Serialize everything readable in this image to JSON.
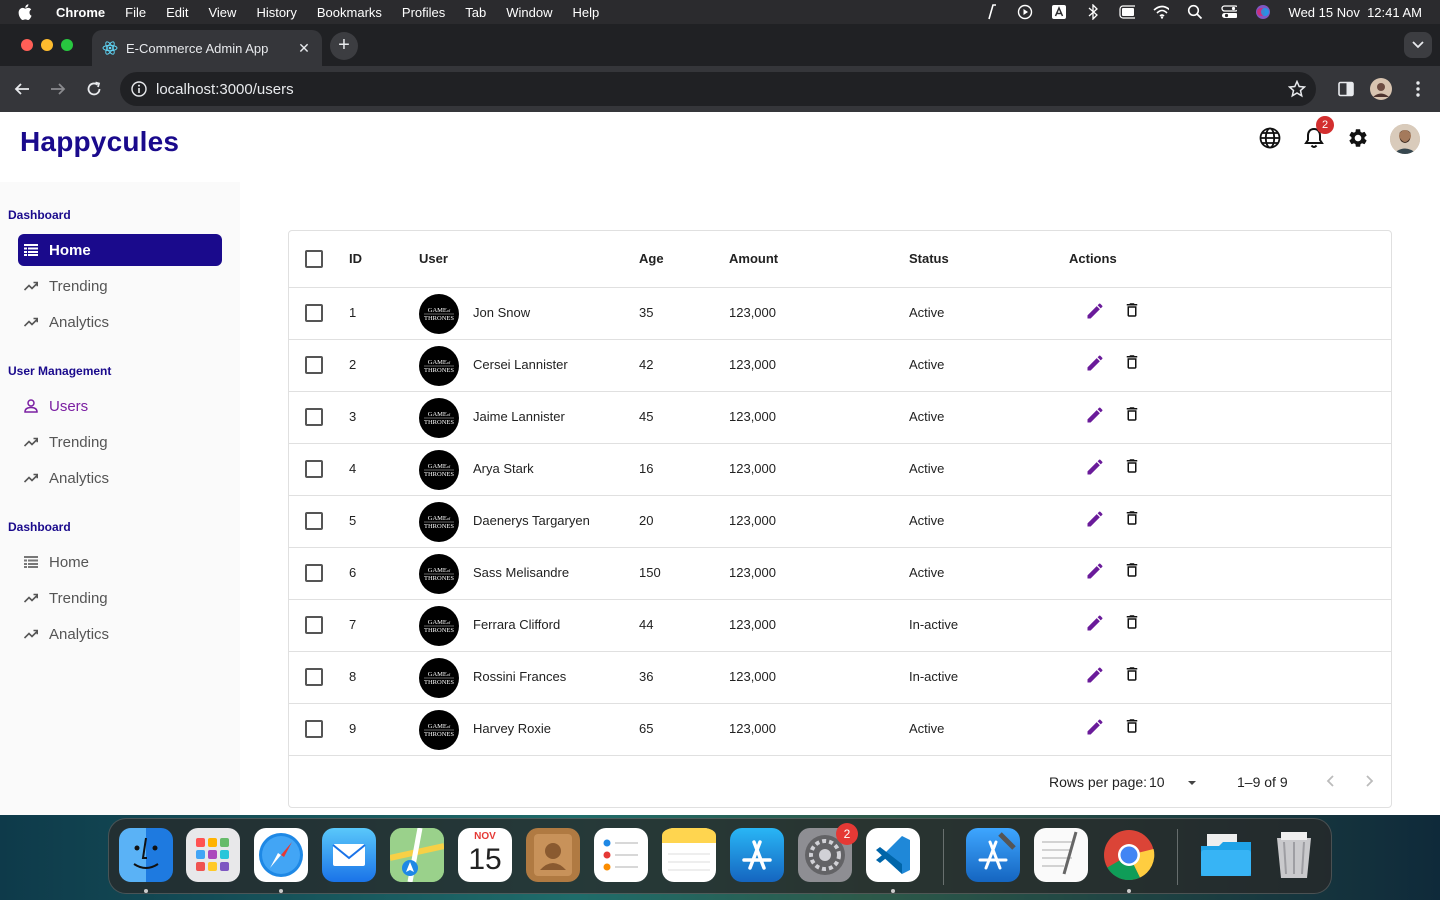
{
  "menubar": {
    "app": "Chrome",
    "items": [
      "File",
      "Edit",
      "View",
      "History",
      "Bookmarks",
      "Profiles",
      "Tab",
      "Window",
      "Help"
    ],
    "datetime": "Wed 15 Nov  12:41 AM"
  },
  "browser": {
    "tab_title": "E-Commerce Admin App",
    "url": "localhost:3000/users"
  },
  "app": {
    "brand": "Happycules",
    "notification_count": "2",
    "colors": {
      "brand": "#1a0a8c",
      "selected": "#7b1fa2",
      "badge": "#d32f2f"
    }
  },
  "sidebar": {
    "sections": [
      {
        "title": "Dashboard",
        "items": [
          {
            "label": "Home",
            "icon": "table-icon",
            "state": "active"
          },
          {
            "label": "Trending",
            "icon": "trending-up-icon"
          },
          {
            "label": "Analytics",
            "icon": "trending-up-icon"
          }
        ]
      },
      {
        "title": "User Management",
        "items": [
          {
            "label": "Users",
            "icon": "person-icon",
            "state": "selected"
          },
          {
            "label": "Trending",
            "icon": "trending-up-icon"
          },
          {
            "label": "Analytics",
            "icon": "trending-up-icon"
          }
        ]
      },
      {
        "title": "Dashboard",
        "items": [
          {
            "label": "Home",
            "icon": "table-icon"
          },
          {
            "label": "Trending",
            "icon": "trending-up-icon"
          },
          {
            "label": "Analytics",
            "icon": "trending-up-icon"
          }
        ]
      }
    ]
  },
  "table": {
    "headers": {
      "id": "ID",
      "user": "User",
      "age": "Age",
      "amount": "Amount",
      "status": "Status",
      "actions": "Actions"
    },
    "rows": [
      {
        "id": "1",
        "user": "Jon Snow",
        "age": "35",
        "amount": "123,000",
        "status": "Active"
      },
      {
        "id": "2",
        "user": "Cersei Lannister",
        "age": "42",
        "amount": "123,000",
        "status": "Active"
      },
      {
        "id": "3",
        "user": "Jaime Lannister",
        "age": "45",
        "amount": "123,000",
        "status": "Active"
      },
      {
        "id": "4",
        "user": "Arya Stark",
        "age": "16",
        "amount": "123,000",
        "status": "Active"
      },
      {
        "id": "5",
        "user": "Daenerys Targaryen",
        "age": "20",
        "amount": "123,000",
        "status": "Active"
      },
      {
        "id": "6",
        "user": "Sass Melisandre",
        "age": "150",
        "amount": "123,000",
        "status": "Active"
      },
      {
        "id": "7",
        "user": "Ferrara Clifford",
        "age": "44",
        "amount": "123,000",
        "status": "In-active"
      },
      {
        "id": "8",
        "user": "Rossini Frances",
        "age": "36",
        "amount": "123,000",
        "status": "In-active"
      },
      {
        "id": "9",
        "user": "Harvey Roxie",
        "age": "65",
        "amount": "123,000",
        "status": "Active"
      }
    ],
    "avatar_logo_text": "GAME of THRONES",
    "footer": {
      "rows_per_page_label": "Rows per page:",
      "rows_per_page_value": "10",
      "range": "1–9 of 9"
    }
  },
  "dock": {
    "apps": [
      "finder",
      "launchpad",
      "safari",
      "mail",
      "maps",
      "calendar",
      "contacts",
      "reminders",
      "notes",
      "app-store",
      "system-settings",
      "vscode",
      "xcode",
      "textedit",
      "chrome",
      "downloads-folder",
      "trash"
    ],
    "calendar": {
      "month": "NOV",
      "day": "15"
    },
    "settings_badge": "2"
  }
}
